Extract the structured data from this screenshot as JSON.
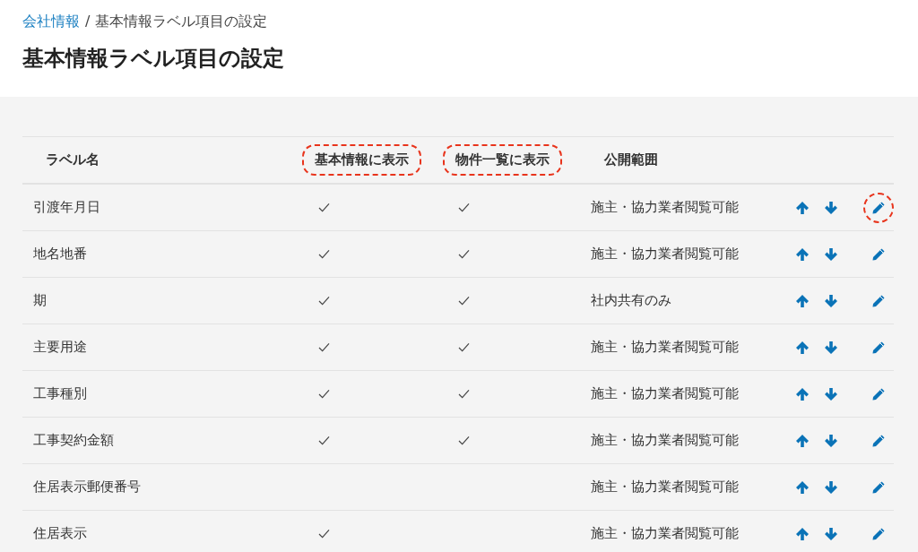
{
  "breadcrumb": {
    "parent": "会社情報",
    "separator": "/",
    "current": "基本情報ラベル項目の設定"
  },
  "title": "基本情報ラベル項目の設定",
  "table": {
    "columns": [
      {
        "label": "ラベル名",
        "highlighted": false
      },
      {
        "label": "基本情報に表示",
        "highlighted": true
      },
      {
        "label": "物件一覧に表示",
        "highlighted": true
      },
      {
        "label": "公開範囲",
        "highlighted": false
      }
    ],
    "rows": [
      {
        "name": "引渡年月日",
        "show_basic": true,
        "show_list": true,
        "scope": "施主・協力業者閲覧可能",
        "edit_highlighted": true
      },
      {
        "name": "地名地番",
        "show_basic": true,
        "show_list": true,
        "scope": "施主・協力業者閲覧可能",
        "edit_highlighted": false
      },
      {
        "name": "期",
        "show_basic": true,
        "show_list": true,
        "scope": "社内共有のみ",
        "edit_highlighted": false
      },
      {
        "name": "主要用途",
        "show_basic": true,
        "show_list": true,
        "scope": "施主・協力業者閲覧可能",
        "edit_highlighted": false
      },
      {
        "name": "工事種別",
        "show_basic": true,
        "show_list": true,
        "scope": "施主・協力業者閲覧可能",
        "edit_highlighted": false
      },
      {
        "name": "工事契約金額",
        "show_basic": true,
        "show_list": true,
        "scope": "施主・協力業者閲覧可能",
        "edit_highlighted": false
      },
      {
        "name": "住居表示郵便番号",
        "show_basic": false,
        "show_list": false,
        "scope": "施主・協力業者閲覧可能",
        "edit_highlighted": false
      },
      {
        "name": "住居表示",
        "show_basic": true,
        "show_list": false,
        "scope": "施主・協力業者閲覧可能",
        "edit_highlighted": false
      }
    ]
  }
}
